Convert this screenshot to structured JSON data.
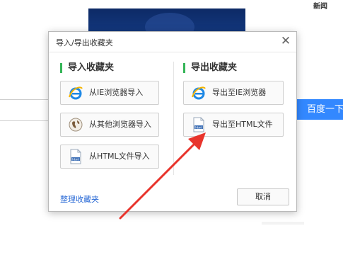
{
  "background": {
    "news_label": "新闻",
    "search_button_label": "百度一下"
  },
  "dialog": {
    "title": "导入/导出收藏夹",
    "close_glyph": "✕",
    "import_section": {
      "title": "导入收藏夹",
      "buttons": [
        {
          "label": "从IE浏览器导入",
          "icon": "ie-icon"
        },
        {
          "label": "从其他浏览器导入",
          "icon": "globe-icon"
        },
        {
          "label": "从HTML文件导入",
          "icon": "html-file-icon"
        }
      ]
    },
    "export_section": {
      "title": "导出收藏夹",
      "buttons": [
        {
          "label": "导出至IE浏览器",
          "icon": "ie-icon"
        },
        {
          "label": "导出至HTML文件",
          "icon": "html-file-icon"
        }
      ]
    },
    "manage_link": "整理收藏夹",
    "cancel_label": "取消",
    "html_icon_text": "html"
  },
  "colors": {
    "accent_green": "#35b558",
    "link_blue": "#2a6ad6",
    "arrow_red": "#e8342c",
    "ie_blue": "#1e88e5"
  }
}
